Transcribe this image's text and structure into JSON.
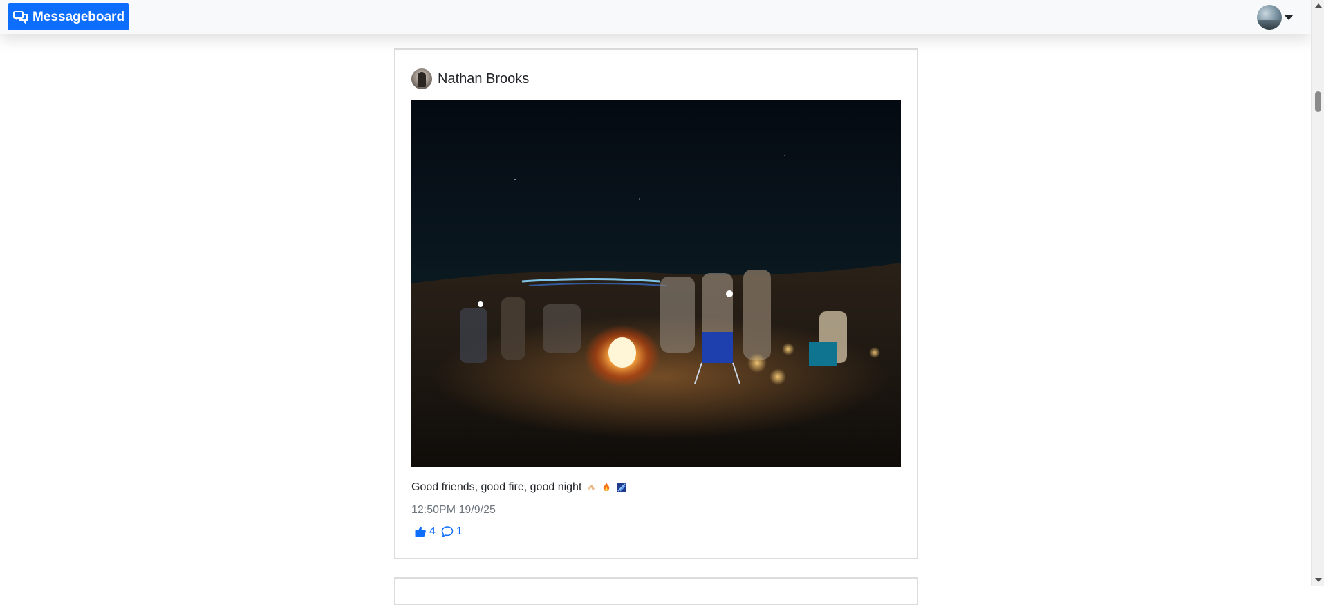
{
  "navbar": {
    "brand_label": "Messageboard",
    "brand_icon": "chat-bubbles-icon",
    "user_avatar": "user-avatar",
    "menu_icon": "caret-down-icon"
  },
  "post": {
    "author": "Nathan Brooks",
    "text": "Good friends, good fire, good night",
    "emojis": [
      "clinking-hands-emoji",
      "fire-emoji",
      "sparkles-emoji"
    ],
    "timestamp": "12:50PM 19/9/25",
    "likes": "4",
    "comments": "1",
    "like_icon": "thumbs-up-icon",
    "comment_icon": "comment-icon"
  },
  "colors": {
    "accent": "#0d6efd",
    "navbar_bg": "#f8f9fa",
    "muted_text": "#6c757d",
    "card_border": "#dcdcdc"
  }
}
